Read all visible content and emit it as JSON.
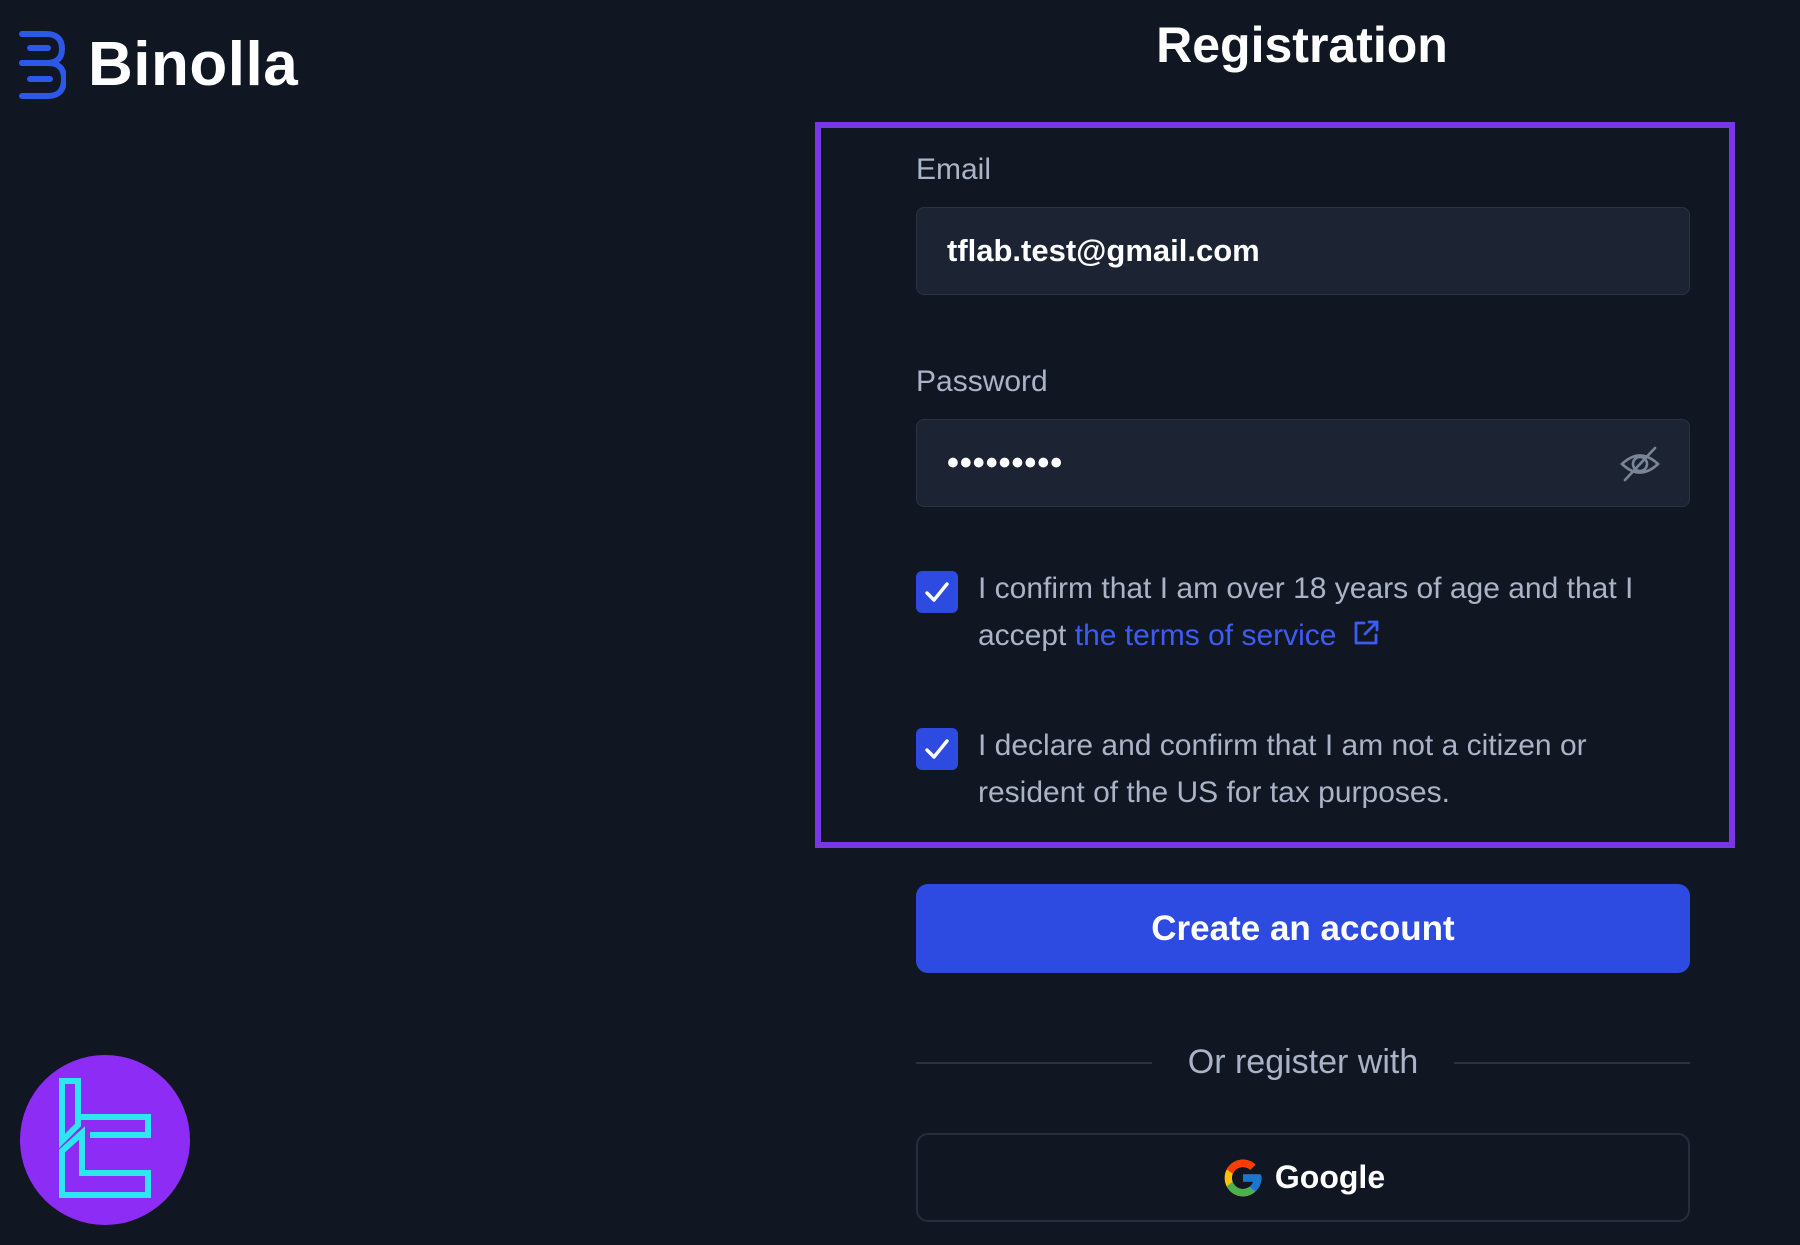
{
  "brand": {
    "name": "Binolla",
    "icon": "binolla-b-logo",
    "accent": "#2d57e6"
  },
  "page": {
    "title": "Registration"
  },
  "form": {
    "email_label": "Email",
    "email_value": "tflab.test@gmail.com",
    "password_label": "Password",
    "password_value": "•••••••••",
    "password_toggle_icon": "eye-slash-icon",
    "age_checkbox_checked": true,
    "age_text": "I confirm that I am over 18 years of age and that I accept",
    "terms_link": "the terms of service",
    "terms_icon": "external-link-icon",
    "us_checkbox_checked": true,
    "us_text": "I declare and confirm that I am not a citizen or resident of the US for tax purposes.",
    "submit_label": "Create an account",
    "divider_text": "Or register with",
    "google_label": "Google"
  },
  "colors": {
    "background": "#111722",
    "input_bg": "#1c2433",
    "primary": "#2d4be0",
    "link": "#3d5cf5",
    "highlight": "#7a36e8",
    "muted_text": "#aab3c7",
    "watermark": "#8d2cf5"
  },
  "watermark": {
    "icon": "tflab-logo-badge"
  }
}
